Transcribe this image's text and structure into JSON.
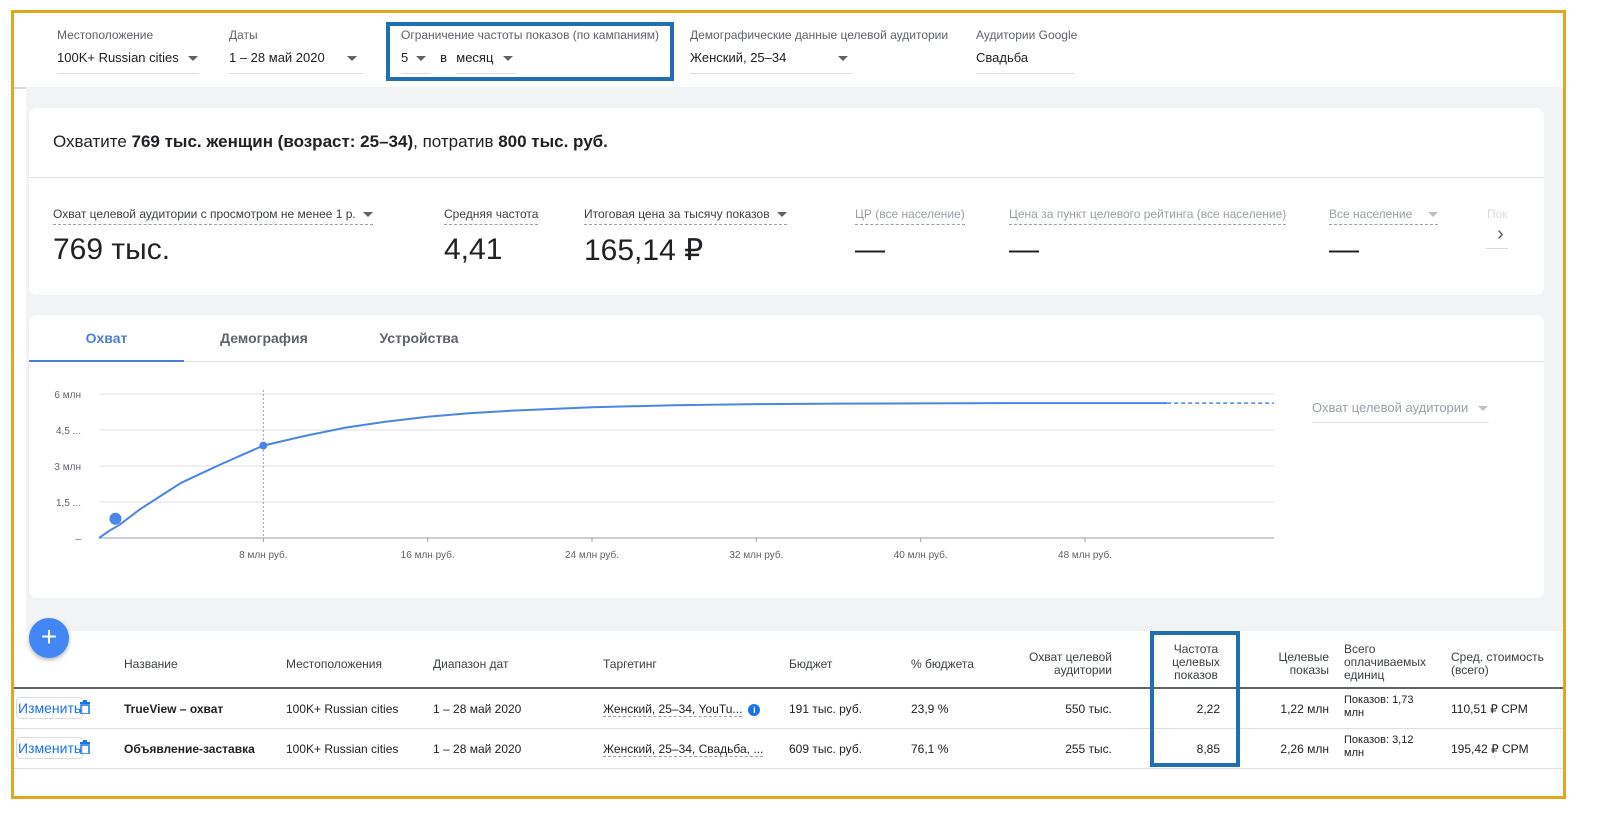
{
  "filters": {
    "location": {
      "label": "Местоположение",
      "value": "100K+ Russian cities"
    },
    "dates": {
      "label": "Даты",
      "value": "1 – 28 май 2020"
    },
    "frequency": {
      "label": "Ограничение частоты показов (по кампаниям)",
      "count": "5",
      "in": "в",
      "period": "месяц"
    },
    "demographics": {
      "label": "Демографические данные целевой аудитории",
      "value": "Женский, 25–34"
    },
    "audiences": {
      "label": "Аудитории Google",
      "value": "Свадьба"
    }
  },
  "summary": {
    "headline_prefix": "Охватите ",
    "headline_reach": "769 тыс. женщин (возраст: 25–34)",
    "headline_mid": ", потратив ",
    "headline_budget": "800 тыс. руб.",
    "metrics": [
      {
        "label": "Охват целевой аудитории с просмотром не менее 1 р.",
        "value": "769 тыс."
      },
      {
        "label": "Средняя частота",
        "value": "4,41"
      },
      {
        "label": "Итоговая цена за тысячу показов",
        "value": "165,14 ₽"
      },
      {
        "label": "ЦР (все население)",
        "value": "—"
      },
      {
        "label": "Цена за пункт целевого рейтинга (все население)",
        "value": "—"
      },
      {
        "label": "Все население",
        "value": "—"
      },
      {
        "label": "Показ",
        "value": ""
      }
    ]
  },
  "tabs": [
    "Охват",
    "Демография",
    "Устройства"
  ],
  "chart_metric_select": "Охват целевой аудитории",
  "chart_data": {
    "type": "line",
    "title": "",
    "xlabel": "",
    "ylabel": "",
    "y_tick_labels": [
      "6 млн",
      "4,5 ...",
      "3 млн",
      "1,5 ...",
      "–"
    ],
    "x_tick_labels": [
      "8 млн руб.",
      "16 млн руб.",
      "24 млн руб.",
      "32 млн руб.",
      "40 млн руб.",
      "48 млн руб."
    ],
    "ylim": [
      0,
      6
    ],
    "xlim": [
      0,
      57.2
    ],
    "x_unit": "млн руб.",
    "y_unit": "млн",
    "series": [
      {
        "values_x": [
          0,
          0.5,
          1,
          2,
          3,
          4,
          5,
          6,
          8,
          10,
          12,
          14,
          16,
          18,
          20,
          24,
          28,
          32,
          36,
          40,
          44,
          48,
          52
        ],
        "values_y": [
          0,
          0.3,
          0.55,
          1.2,
          1.75,
          2.3,
          2.7,
          3.1,
          3.85,
          4.25,
          4.6,
          4.85,
          5.05,
          5.2,
          5.3,
          5.45,
          5.53,
          5.58,
          5.6,
          5.61,
          5.62,
          5.62,
          5.62
        ],
        "projected_x": [
          52,
          57.2
        ],
        "projected_y": [
          5.62,
          5.62
        ]
      }
    ],
    "points": [
      {
        "x": 0.8,
        "y": 0.8
      },
      {
        "x": 8,
        "y": 3.85
      }
    ],
    "guide_x": 8,
    "grid": true
  },
  "table": {
    "headers": [
      "Название",
      "Местоположения",
      "Диапазон дат",
      "Таргетинг",
      "Бюджет",
      "% бюджета",
      "Охват целевой аудитории",
      "Частота целевых показов",
      "Целевые показы",
      "Всего оплачиваемых единиц",
      "Сред. стоимость (всего)"
    ],
    "edit_label": "Изменить",
    "rows": [
      {
        "name": "TrueView – охват",
        "locations": "100K+ Russian cities",
        "dates": "1 – 28 май 2020",
        "targeting": "Женский, 25–34, YouTu...",
        "budget": "191 тыс. руб.",
        "budget_pct": "23,9 %",
        "reach": "550 тыс.",
        "frequency": "2,22",
        "impressions": "1,22 млн",
        "billable": "Показов: 1,73 млн",
        "avg_cost": "110,51 ₽ CPM"
      },
      {
        "name": "Объявление-заставка",
        "locations": "100K+ Russian cities",
        "dates": "1 – 28 май 2020",
        "targeting": "Женский, 25–34, Свадьба, ...",
        "budget": "609 тыс. руб.",
        "budget_pct": "76,1 %",
        "reach": "255 тыс.",
        "frequency": "8,85",
        "impressions": "2,26 млн",
        "billable": "Показов: 3,12 млн",
        "avg_cost": "195,42 ₽ CPM"
      }
    ]
  },
  "colors": {
    "accent": "#4a7fd6",
    "highlight_border": "#1f6fb2",
    "frame": "#e4a521",
    "line": "#4a86e8"
  }
}
